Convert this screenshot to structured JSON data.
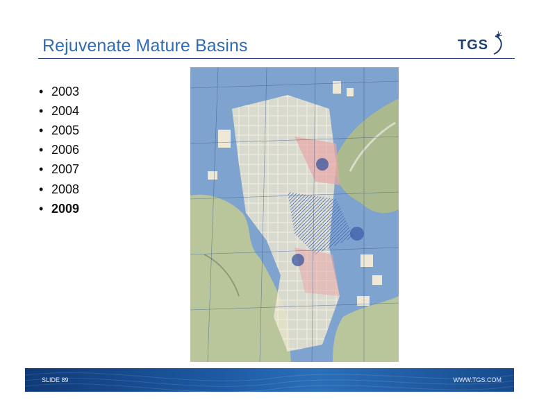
{
  "slide": {
    "title": "Rejuvenate Mature Basins",
    "bullet_glyph": "•",
    "years": [
      "2003",
      "2004",
      "2005",
      "2006",
      "2007",
      "2008",
      "2009"
    ],
    "highlighted_year": "2009"
  },
  "logo": {
    "text": "TGS",
    "icon": "tgs-swoosh-icon"
  },
  "map": {
    "icon": "north-sea-map-image"
  },
  "footer": {
    "slide_label": "SLIDE 89",
    "website": "WWW.TGS.COM"
  },
  "colors": {
    "title": "#2f6bb3",
    "rule": "#1f3f74",
    "sea": "#7fa3cf",
    "land": "#b9c69c",
    "footer": "#1d5aa3"
  }
}
